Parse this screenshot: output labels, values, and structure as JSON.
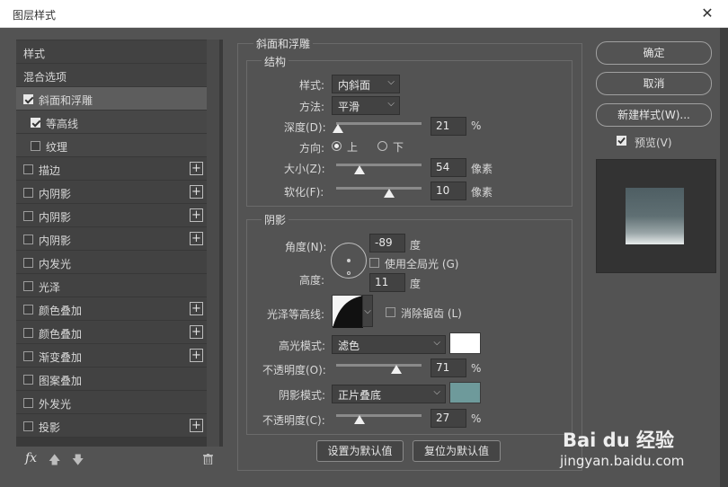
{
  "window": {
    "title": "图层样式",
    "close_glyph": "✕"
  },
  "left_list": {
    "header": "样式",
    "blend_options": "混合选项",
    "items": [
      {
        "label": "斜面和浮雕",
        "checked": true,
        "selected": true
      },
      {
        "label": "等高线",
        "checked": true,
        "sub": true
      },
      {
        "label": "纹理",
        "checked": false,
        "sub": true
      },
      {
        "label": "描边",
        "checked": false,
        "plus": true
      },
      {
        "label": "内阴影",
        "checked": false,
        "plus": true
      },
      {
        "label": "内阴影",
        "checked": false,
        "plus": true
      },
      {
        "label": "内阴影",
        "checked": false,
        "plus": true
      },
      {
        "label": "内发光",
        "checked": false
      },
      {
        "label": "光泽",
        "checked": false
      },
      {
        "label": "颜色叠加",
        "checked": false,
        "plus": true
      },
      {
        "label": "颜色叠加",
        "checked": false,
        "plus": true
      },
      {
        "label": "渐变叠加",
        "checked": false,
        "plus": true
      },
      {
        "label": "图案叠加",
        "checked": false
      },
      {
        "label": "外发光",
        "checked": false
      },
      {
        "label": "投影",
        "checked": false,
        "plus": true
      }
    ],
    "fx_label": "fx"
  },
  "bevel": {
    "group_title": "斜面和浮雕",
    "structure_title": "结构",
    "style_label": "样式:",
    "style_value": "内斜面",
    "method_label": "方法:",
    "method_value": "平滑",
    "depth_label": "深度(D):",
    "depth_value": "21",
    "depth_unit": "%",
    "direction_label": "方向:",
    "direction_up": "上",
    "direction_down": "下",
    "size_label": "大小(Z):",
    "size_value": "54",
    "size_unit": "像素",
    "soften_label": "软化(F):",
    "soften_value": "10",
    "soften_unit": "像素",
    "depth_level": 0.02,
    "size_level": 0.27,
    "soften_level": 0.62
  },
  "shading": {
    "title": "阴影",
    "angle_label": "角度(N):",
    "angle_value": "-89",
    "angle_unit": "度",
    "global_light_label": "使用全局光 (G)",
    "altitude_label": "高度:",
    "altitude_value": "11",
    "altitude_unit": "度",
    "gloss_contour_label": "光泽等高线:",
    "antialias_label": "消除锯齿 (L)",
    "highlight_mode_label": "高光模式:",
    "highlight_mode_value": "滤色",
    "highlight_color": "#ffffff",
    "highlight_opacity_label": "不透明度(O):",
    "highlight_opacity_value": "71",
    "highlight_opacity_unit": "%",
    "highlight_opacity_level": 0.71,
    "shadow_mode_label": "阴影模式:",
    "shadow_mode_value": "正片叠底",
    "shadow_color": "#6e9a9b",
    "shadow_opacity_label": "不透明度(C):",
    "shadow_opacity_value": "27",
    "shadow_opacity_unit": "%",
    "shadow_opacity_level": 0.27
  },
  "buttons": {
    "set_default": "设置为默认值",
    "reset_default": "复位为默认值",
    "ok": "确定",
    "cancel": "取消",
    "new_style": "新建样式(W)...",
    "preview_label": "预览(V)"
  },
  "watermark": {
    "brand": "Bai du 经验",
    "url": "jingyan.baidu.com"
  }
}
